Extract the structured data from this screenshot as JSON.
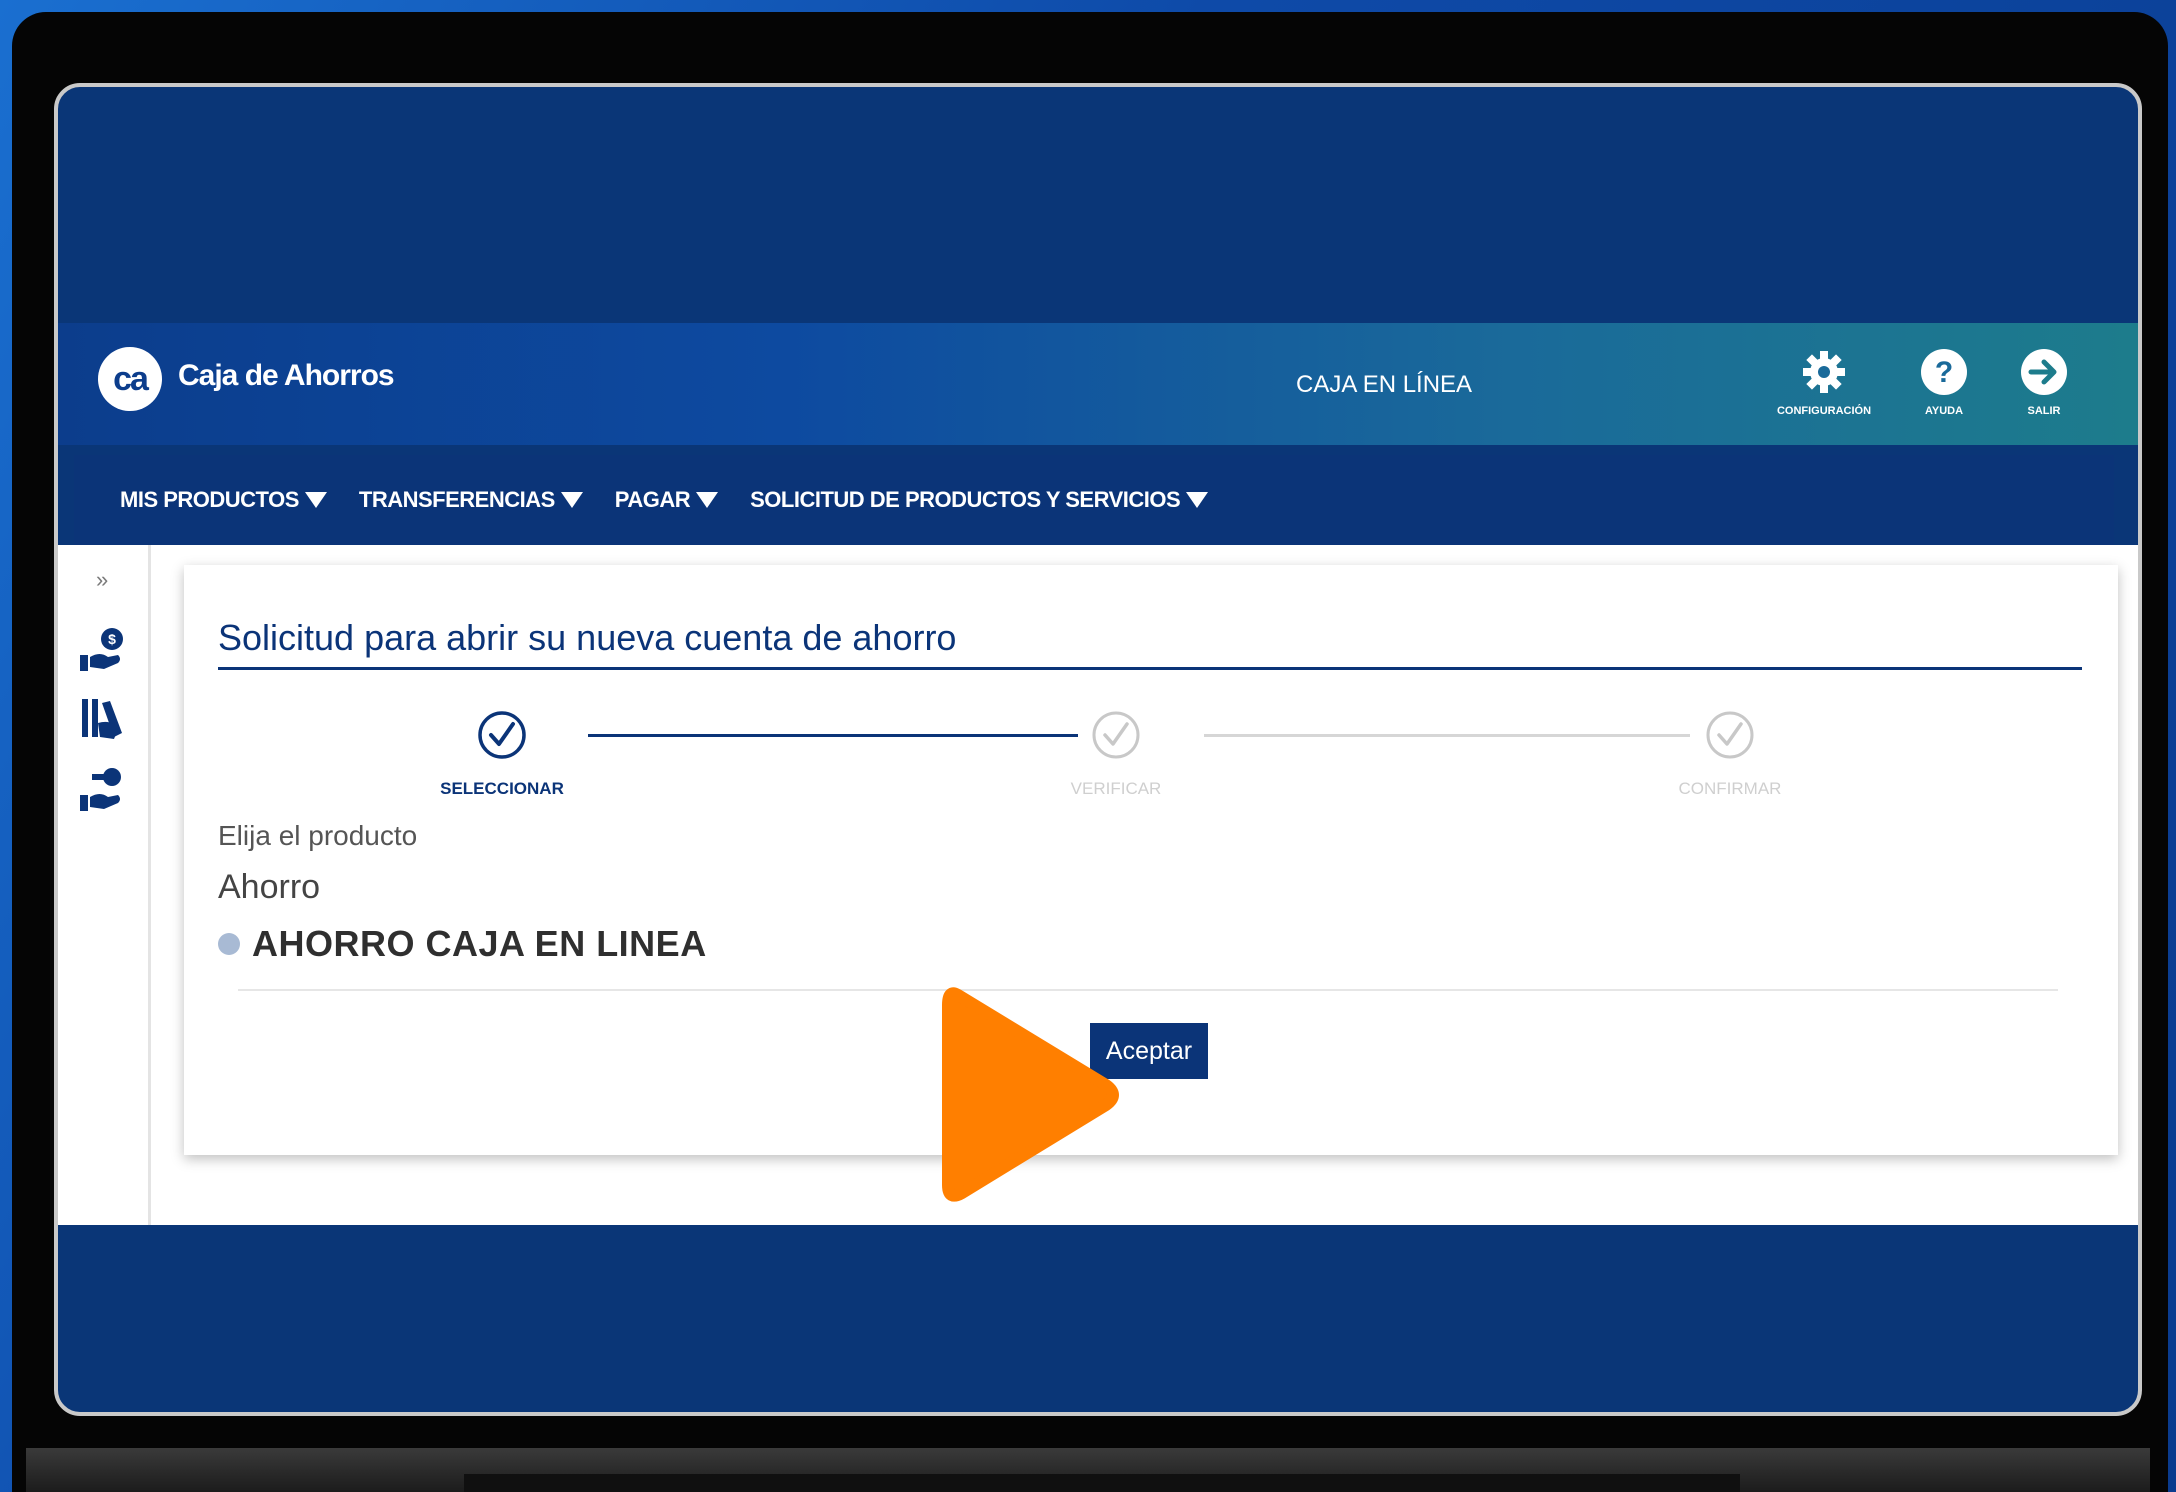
{
  "header": {
    "brand_name": "Caja de Ahorros",
    "logo_text": "ca",
    "center_title": "CAJA EN LÍNEA",
    "icons": [
      {
        "icon": "gear-icon",
        "label": "CONFIGURACIÓN"
      },
      {
        "icon": "help-icon",
        "label": "AYUDA"
      },
      {
        "icon": "logout-icon",
        "label": "SALIR"
      }
    ]
  },
  "nav": {
    "items": [
      {
        "label": "MIS PRODUCTOS"
      },
      {
        "label": "TRANSFERENCIAS"
      },
      {
        "label": "PAGAR"
      },
      {
        "label": "SOLICITUD DE PRODUCTOS Y SERVICIOS"
      }
    ]
  },
  "sidebar": {
    "expander": "»",
    "icons": [
      "hand-money-icon",
      "documents-icon",
      "hand-key-icon"
    ]
  },
  "main": {
    "title": "Solicitud para abrir su nueva cuenta de ahorro",
    "steps": [
      {
        "label": "SELECCIONAR",
        "state": "active"
      },
      {
        "label": "VERIFICAR",
        "state": "inactive"
      },
      {
        "label": "CONFIRMAR",
        "state": "inactive"
      }
    ],
    "product_label": "Elija el producto",
    "product_category": "Ahorro",
    "product_option": "AHORRO CAJA EN LINEA",
    "accept_button": "Aceptar"
  },
  "colors": {
    "brand_navy": "#0b3478",
    "header_teal": "#1d7c8c",
    "play_orange": "#ff7f00",
    "step_active": "#0b3478",
    "step_inactive": "#c8c8c8"
  }
}
